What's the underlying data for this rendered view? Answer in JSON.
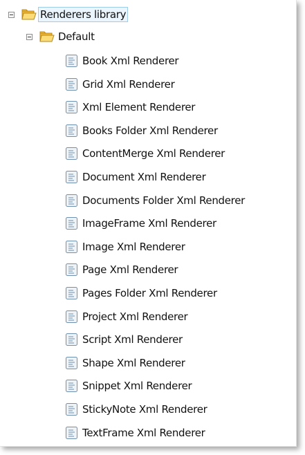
{
  "tree": {
    "root": {
      "label": "Renderers library",
      "icon": "folder-icon",
      "expanded": true
    },
    "group": {
      "label": "Default",
      "icon": "folder-icon",
      "expanded": true
    },
    "items": [
      {
        "label": "Book Xml Renderer",
        "icon": "document-icon"
      },
      {
        "label": "Grid Xml Renderer",
        "icon": "document-icon"
      },
      {
        "label": "Xml Element Renderer",
        "icon": "document-icon"
      },
      {
        "label": "Books Folder Xml Renderer",
        "icon": "document-icon"
      },
      {
        "label": "ContentMerge Xml Renderer",
        "icon": "document-icon"
      },
      {
        "label": "Document Xml Renderer",
        "icon": "document-icon"
      },
      {
        "label": "Documents Folder Xml Renderer",
        "icon": "document-icon"
      },
      {
        "label": "ImageFrame Xml Renderer",
        "icon": "document-icon"
      },
      {
        "label": "Image Xml Renderer",
        "icon": "document-icon"
      },
      {
        "label": "Page Xml Renderer",
        "icon": "document-icon"
      },
      {
        "label": "Pages Folder Xml Renderer",
        "icon": "document-icon"
      },
      {
        "label": "Project Xml Renderer",
        "icon": "document-icon"
      },
      {
        "label": "Script Xml Renderer",
        "icon": "document-icon"
      },
      {
        "label": "Shape Xml Renderer",
        "icon": "document-icon"
      },
      {
        "label": "Snippet Xml Renderer",
        "icon": "document-icon"
      },
      {
        "label": "StickyNote Xml Renderer",
        "icon": "document-icon"
      },
      {
        "label": "TextFrame Xml Renderer",
        "icon": "document-icon"
      }
    ]
  },
  "colors": {
    "selection_background": "#eaf5fd",
    "selection_border": "#9ecbe8",
    "folder_yellow": "#f7c948"
  }
}
